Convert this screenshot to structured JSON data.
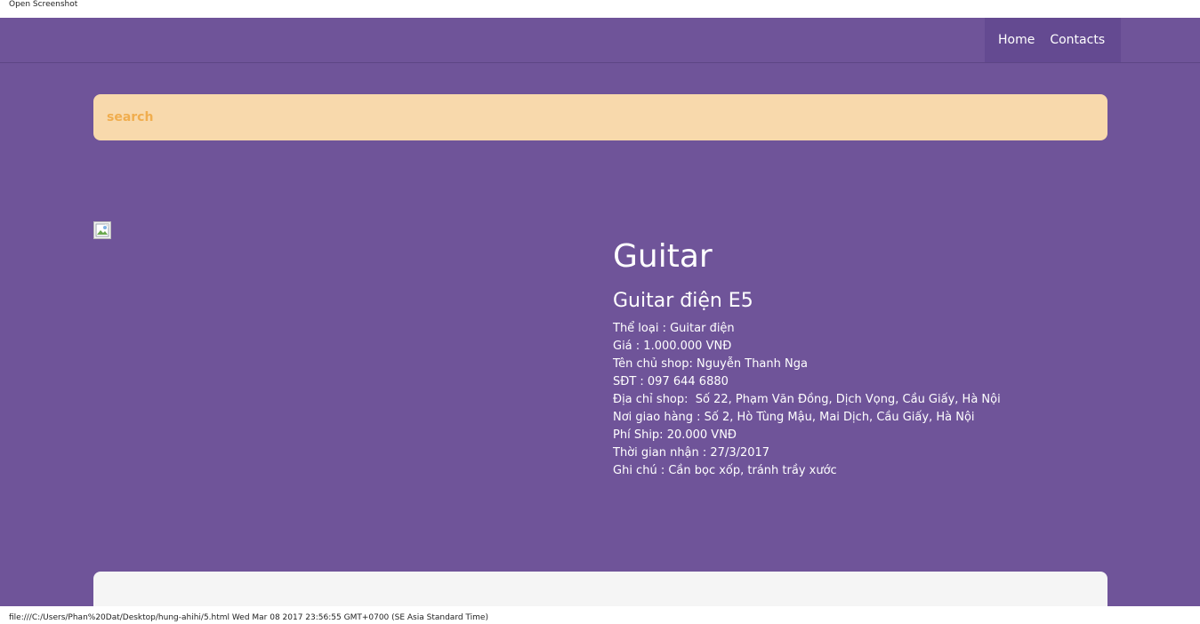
{
  "screenshot": {
    "header": "Open Screenshot",
    "footer": "file:///C:/Users/Phan%20Dat/Desktop/hung-ahihi/5.html Wed Mar 08 2017 23:56:55 GMT+0700 (SE Asia Standard Time)"
  },
  "nav": {
    "items": [
      {
        "label": "Home"
      },
      {
        "label": "Contacts"
      }
    ]
  },
  "search": {
    "placeholder": "search",
    "value": ""
  },
  "product": {
    "image_icon": "broken-image-icon",
    "title": "Guitar",
    "subtitle": "Guitar điện E5",
    "details": [
      "Thể loại : Guitar điện",
      "Giá : 1.000.000 VNĐ",
      "Tên chủ shop: Nguyễn Thanh Nga",
      "SĐT : 097 644 6880",
      "Địa chỉ shop:  Số 22, Phạm Văn Đồng, Dịch Vọng, Cầu Giấy, Hà Nội",
      "Nơi giao hàng : Số 2, Hò Tùng Mậu, Mai Dịch, Cầu Giấy, Hà Nội",
      "Phí Ship: 20.000 VNĐ",
      "Thời gian nhận : 27/3/2017",
      "Ghi chú : Cần bọc xốp, tránh trầy xước"
    ]
  },
  "colors": {
    "background": "#6f5499",
    "nav_active": "#644a91",
    "search_bg": "#f8d9ac",
    "search_text": "#f0ad4e",
    "panel": "#f5f5f5"
  }
}
